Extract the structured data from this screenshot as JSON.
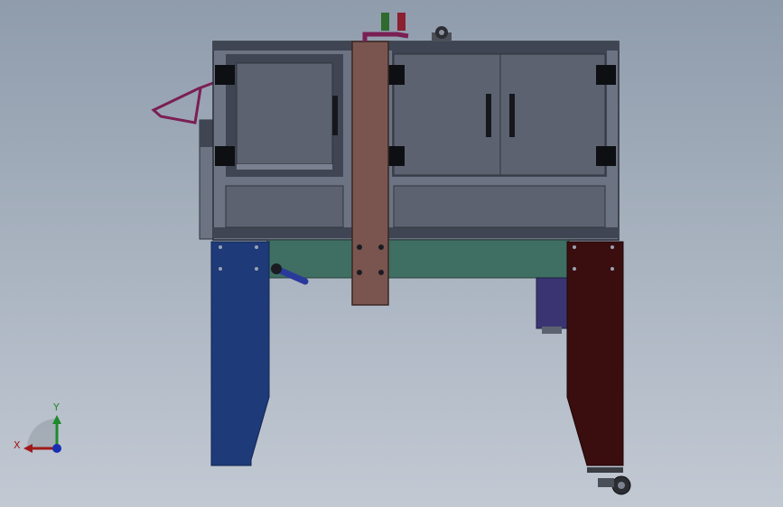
{
  "viewport": {
    "background_top": "#8f9cac",
    "background_bottom": "#c2c9d3"
  },
  "triad": {
    "x_label": "X",
    "y_label": "Y",
    "x_color": "#a01818",
    "y_color": "#1c8a2c",
    "z_color": "#1a2fb0"
  },
  "colors": {
    "frame": "#6c7382",
    "frame_dark": "#3f4552",
    "panel": "#5d6270",
    "center_column": "#7a5550",
    "left_leg": "#1e3a78",
    "right_leg": "#3a0d0f",
    "conveyor_belt": "#3f6e62",
    "motor": "#3a3572",
    "handle": "#7a1f54",
    "indicator_green": "#2f6a2f",
    "indicator_red": "#8a2030",
    "crank": "#2a3a9a"
  }
}
